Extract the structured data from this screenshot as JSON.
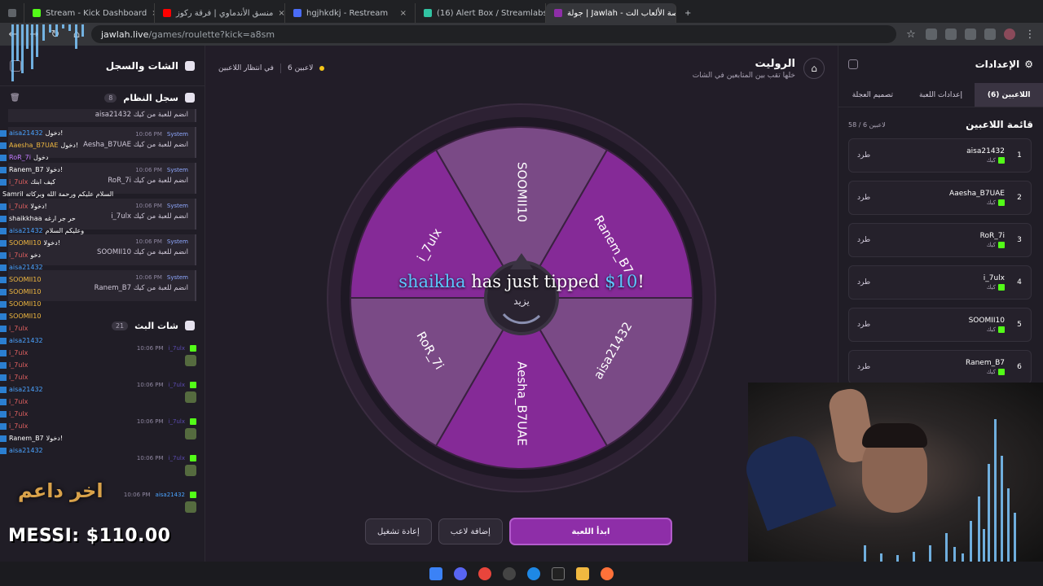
{
  "browser": {
    "tabs": [
      {
        "label": "Stream - Kick Dashboard",
        "color": "#53fc18"
      },
      {
        "label": "منسق الأندماوي | فرقة ركوز",
        "color": "#ff0000"
      },
      {
        "label": "hgjhkdkj - Restream",
        "color": "#4a6cf7"
      },
      {
        "label": "(16) Alert Box / Streamlabs",
        "color": "#31c3a2"
      },
      {
        "label": "جولة | Jawlah - منصة الألعاب الت..",
        "color": "#8e2ea8",
        "active": true
      }
    ],
    "url_host": "jawlah.live",
    "url_path": "/games/roulette?kick=a8sm"
  },
  "left": {
    "title": "الشات والسجل",
    "system_log": {
      "title": "سجل النظام",
      "count": "8",
      "first_msg": "aisa21432 انضم للعبة من كيك",
      "entries": [
        {
          "sender": "System",
          "time": "10:06 PM",
          "text": "Aesha_B7UAE انضم للعبة من كيك"
        },
        {
          "sender": "System",
          "time": "10:06 PM",
          "text": "RoR_7i انضم للعبة من كيك"
        },
        {
          "sender": "System",
          "time": "10:06 PM",
          "text": "i_7ulx انضم للعبة من كيك"
        },
        {
          "sender": "System",
          "time": "10:06 PM",
          "text": "SOOMII10 انضم للعبة من كيك"
        },
        {
          "sender": "System",
          "time": "10:06 PM",
          "text": "Ranem_B7 انضم للعبة من كيك"
        }
      ]
    },
    "stream_chat": {
      "title": "شات البث",
      "count": "21",
      "entries": [
        {
          "user": "i_7ulx",
          "time": "10:06 PM"
        },
        {
          "user": "i_7ulx",
          "time": "10:06 PM"
        },
        {
          "user": "i_7ulx",
          "time": "10:06 PM"
        },
        {
          "user": "i_7ulx",
          "time": "10:06 PM"
        },
        {
          "user": "aisa21432",
          "time": "10:06 PM"
        }
      ]
    }
  },
  "overlay_chat": [
    {
      "user": "aisa21432",
      "msg": "دخول!",
      "cls": "u1"
    },
    {
      "user": "Aaesha_B7UAE",
      "msg": "دخول!",
      "cls": "u3"
    },
    {
      "user": "RoR_7i",
      "msg": "دخول",
      "cls": "u4"
    },
    {
      "user": "Ranem_B7",
      "msg": "دخولا!",
      "cls": "u5"
    },
    {
      "user": "i_7ulx",
      "msg": "كيف ابنك",
      "cls": "u2"
    },
    {
      "user": "Samril",
      "msg": "السلام عليكم ورحمة الله وبركاته",
      "cls": "u5"
    },
    {
      "user": "i_7ulx",
      "msg": "دخولا!",
      "cls": "u2"
    },
    {
      "user": "shaikkhaa",
      "msg": "حر جر ارغه",
      "cls": "u5"
    },
    {
      "user": "aisa21432",
      "msg": "وعليكم السلام",
      "cls": "u1"
    },
    {
      "user": "SOOMII10",
      "msg": "دخولا!",
      "cls": "u3"
    },
    {
      "user": "i_7ulx",
      "msg": "دخو",
      "cls": "u2"
    },
    {
      "user": "aisa21432",
      "msg": "",
      "cls": "u1"
    },
    {
      "user": "SOOMII10",
      "msg": "",
      "cls": "u3"
    },
    {
      "user": "SOOMII10",
      "msg": "",
      "cls": "u3"
    },
    {
      "user": "SOOMII10",
      "msg": "",
      "cls": "u3"
    },
    {
      "user": "SOOMII10",
      "msg": "",
      "cls": "u3"
    },
    {
      "user": "i_7ulx",
      "msg": "",
      "cls": "u2"
    },
    {
      "user": "aisa21432",
      "msg": "",
      "cls": "u1"
    },
    {
      "user": "i_7ulx",
      "msg": "",
      "cls": "u2"
    },
    {
      "user": "i_7ulx",
      "msg": "",
      "cls": "u2"
    },
    {
      "user": "i_7ulx",
      "msg": "",
      "cls": "u2"
    },
    {
      "user": "aisa21432",
      "msg": "",
      "cls": "u1"
    },
    {
      "user": "i_7ulx",
      "msg": "",
      "cls": "u2"
    },
    {
      "user": "i_7ulx",
      "msg": "",
      "cls": "u2"
    },
    {
      "user": "i_7ulx",
      "msg": "",
      "cls": "u2"
    },
    {
      "user": "Ranem_B7",
      "msg": "دخولا!",
      "cls": "u5"
    },
    {
      "user": "aisa21432",
      "msg": "",
      "cls": "u1"
    }
  ],
  "donation_overlay": {
    "last_supporter": "اخر داعم",
    "top_line": "MESSI: $110.00"
  },
  "center": {
    "title": "الروليت",
    "subtitle": "خلها تقب بين المتابعين في الشات",
    "players_label": "6 لاعبين",
    "status": "في انتظار اللاعبين",
    "wheel_center": "يزيد",
    "segments": [
      "SOOMII10",
      "Ranem_B7",
      "aisa21432",
      "Aesha_B7UAE",
      "RoR_7i",
      "i_7ulx"
    ],
    "tip": {
      "name": "shaikha",
      "middle": "has just tipped",
      "amount": "$10",
      "end": "!"
    },
    "buttons": {
      "start": "ابدأ اللعبة",
      "add": "إضافة لاعب",
      "restart": "إعادة تشغيل"
    }
  },
  "right": {
    "title": "الإعدادات",
    "tabs": [
      "اللاعبين (6)",
      "إعدادات اللعبة",
      "تصميم العجلة"
    ],
    "list_title": "قائمة اللاعبين",
    "list_count": "58 / 6 لاعبين",
    "kick_label": "طرد",
    "source_label": "كيك",
    "players": [
      {
        "idx": "1",
        "name": "aisa21432"
      },
      {
        "idx": "2",
        "name": "Aaesha_B7UAE"
      },
      {
        "idx": "3",
        "name": "RoR_7i"
      },
      {
        "idx": "4",
        "name": "i_7ulx"
      },
      {
        "idx": "5",
        "name": "SOOMII10"
      },
      {
        "idx": "6",
        "name": "Ranem_B7"
      }
    ]
  },
  "colors": {
    "segment_dark": "#852a97",
    "segment_light": "#7a4a86",
    "accent": "#8e2ea8",
    "kick_green": "#53fc18"
  }
}
